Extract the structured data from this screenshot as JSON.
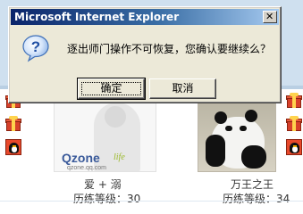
{
  "dialog": {
    "title": "Microsoft Internet Explorer",
    "close_glyph": "✕",
    "message": "逐出师门操作不可恢复，您确认要继续么？",
    "ok_label": "确定",
    "cancel_label": "取消",
    "icon": "question-icon"
  },
  "background": {
    "cards": [
      {
        "name": "爱 + 溺",
        "level": "历练等级：30",
        "logo_text": "Qzone",
        "logo_sub": "life",
        "logo_url": "qzone.qq.com"
      },
      {
        "name": "万王之王",
        "level": "历练等级：34"
      }
    ]
  }
}
